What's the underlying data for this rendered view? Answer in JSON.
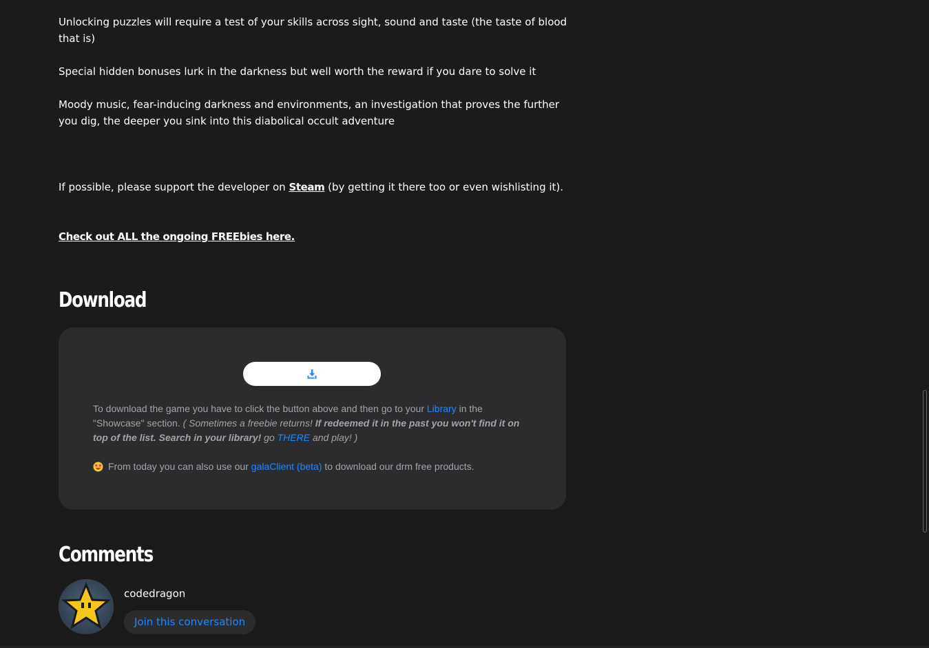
{
  "description": {
    "paragraph1": "Unlocking puzzles will require a test of your skills across sight, sound and taste (the taste of blood that is)",
    "paragraph2": "Special hidden bonuses lurk in the darkness but well worth the reward if you dare to solve it",
    "paragraph3": "Moody music, fear-inducing darkness and environments, an investigation that proves the further you dig, the deeper you sink into this diabolical occult adventure",
    "support_prefix": "If possible, please support the developer on ",
    "support_link": "Steam",
    "support_suffix": " (by getting it there too or even wishlisting it).",
    "freebies_link": "Check out ALL the ongoing FREEbies here."
  },
  "download": {
    "heading": "Download",
    "button_icon": "download-icon",
    "instructions_prefix": "To download the game you have to click the button above and then go to your ",
    "library_link": "Library",
    "instructions_mid": " in the \"Showcase\" section. ",
    "note_open": "( Sometimes a freebie returns! ",
    "note_bold": "If redeemed it in the past you won't find it on top of the list. Search in your library!",
    "note_go": " go ",
    "there_link": "THERE",
    "note_close": " and play! )",
    "client_emoji": "star-struck-emoji",
    "client_prefix": "From today you can also use our ",
    "client_link": "galaClient (beta)",
    "client_suffix": " to download our drm free products."
  },
  "comments": {
    "heading": "Comments",
    "username": "codedragon",
    "avatar_icon": "star-avatar-icon",
    "join_label": "Join this conversation"
  },
  "colors": {
    "background": "#1b1b1c",
    "panel": "#2c2c2e",
    "accent_link": "#1e88ff",
    "muted_text": "#a4a4a8"
  }
}
